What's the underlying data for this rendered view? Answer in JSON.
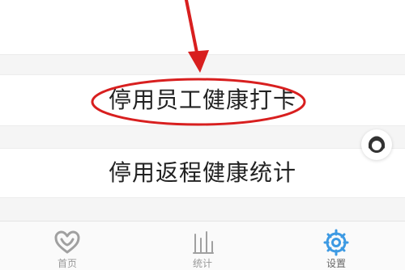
{
  "menu": {
    "disable_staff_health_checkin_label": "停用员工健康打卡",
    "disable_return_trip_health_stats_label": "停用返程健康统计"
  },
  "bottom_nav": {
    "items": [
      {
        "label": "首页",
        "icon": "heart-icon"
      },
      {
        "label": "统计",
        "icon": "bar-chart-icon"
      },
      {
        "label": "设置",
        "icon": "gear-icon"
      }
    ],
    "active_item": "设置"
  },
  "colors": {
    "annotation": "#d81f1f",
    "active_blue": "#3d9ae3",
    "icon_gray": "#a0a0a0"
  },
  "floating_button": {
    "icon": "customer-service-icon"
  }
}
